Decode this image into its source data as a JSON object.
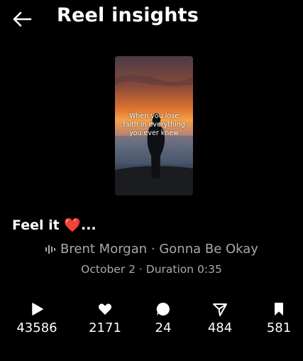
{
  "header": {
    "title": "Reel insights",
    "back_icon": "arrow-left-icon"
  },
  "reel": {
    "overlay_text": "When you lose\nfaith in everything\nyou ever knew",
    "caption": "Feel it ❤️...",
    "audio": "Brent Morgan · Gonna Be Okay",
    "audio_icon": "audio-wave-icon",
    "date_duration": "October 2 · Duration 0:35"
  },
  "metrics": [
    {
      "icon": "play-icon",
      "value": "43586"
    },
    {
      "icon": "heart-icon",
      "value": "2171"
    },
    {
      "icon": "comment-icon",
      "value": "24"
    },
    {
      "icon": "share-icon",
      "value": "484"
    },
    {
      "icon": "bookmark-icon",
      "value": "581"
    }
  ],
  "colors": {
    "background": "#000000",
    "text": "#ffffff",
    "muted": "#a8a8a8"
  }
}
